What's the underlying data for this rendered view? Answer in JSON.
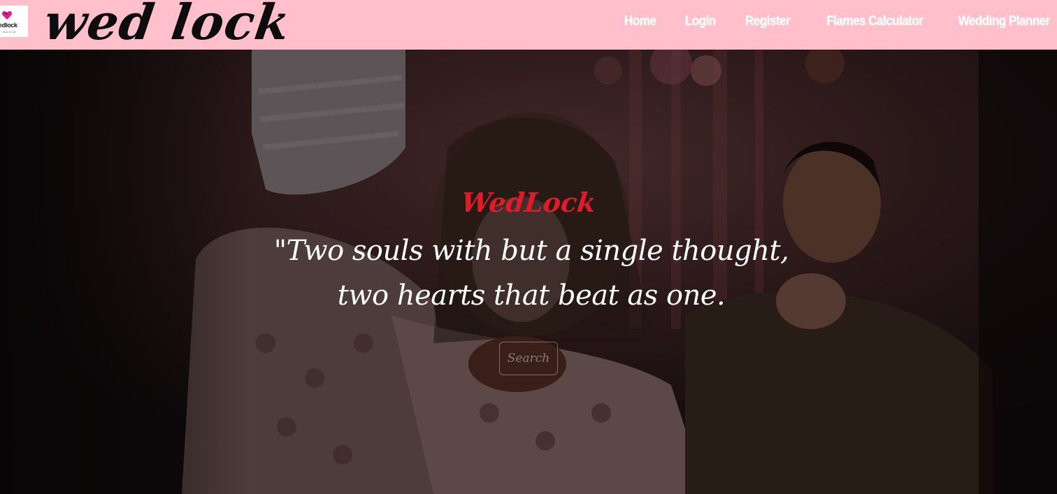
{
  "header": {
    "logo": {
      "text": "edlock",
      "tagline": "love for all"
    },
    "brand": "wed lock",
    "nav": [
      {
        "label": "Home"
      },
      {
        "label": "Login"
      },
      {
        "label": "Register"
      },
      {
        "label": "Flames Calculator"
      },
      {
        "label": "Wedding Planner"
      }
    ]
  },
  "hero": {
    "title": "WedLock",
    "quote": "\"Two souls with but a single thought, two hearts that beat as one.",
    "search_label": "Search"
  },
  "colors": {
    "navbar_bg": "#ffc0cb",
    "title_red": "#e01c2a"
  }
}
